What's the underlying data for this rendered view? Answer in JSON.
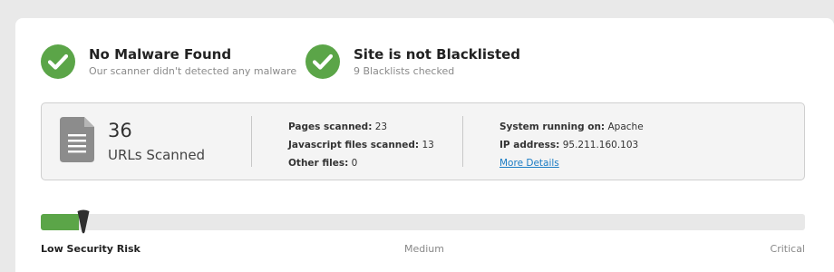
{
  "status_malware": {
    "title": "No Malware Found",
    "subtitle": "Our scanner didn't detected any malware",
    "icon": "check-circle-icon"
  },
  "status_blacklist": {
    "title": "Site is not Blacklisted",
    "subtitle": "9 Blacklists checked",
    "icon": "check-circle-icon"
  },
  "scan": {
    "icon": "document-icon",
    "url_count": "36",
    "url_label": "URLs Scanned",
    "pages_label": "Pages scanned:",
    "pages_value": "23",
    "js_label": "Javascript files scanned:",
    "js_value": "13",
    "other_label": "Other files:",
    "other_value": "0",
    "system_label": "System running on:",
    "system_value": "Apache",
    "ip_label": "IP address:",
    "ip_value": "95.211.160.103",
    "more_details": "More Details"
  },
  "risk": {
    "level_fraction": 0.05,
    "low_label": "Low Security Risk",
    "medium_label": "Medium",
    "critical_label": "Critical"
  },
  "colors": {
    "success_green": "#5ba548",
    "link_blue": "#1a7cc4"
  }
}
